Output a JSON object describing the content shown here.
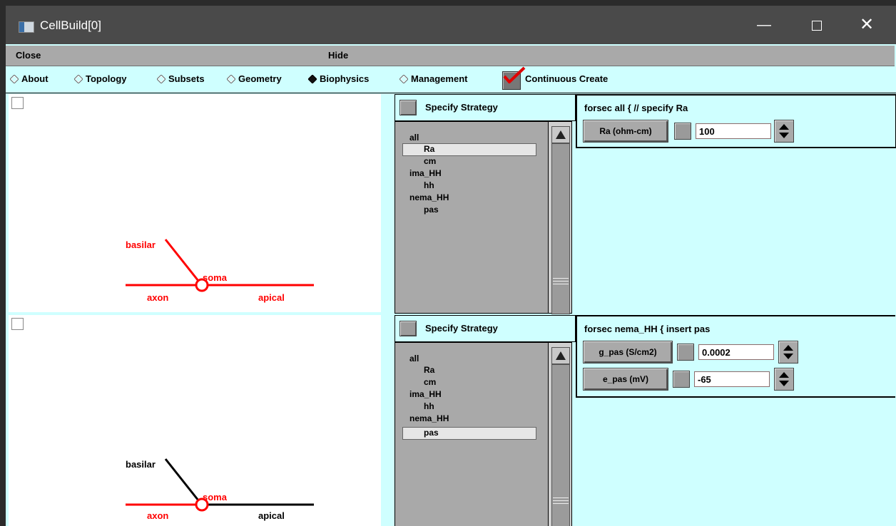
{
  "window": {
    "title": "CellBuild[0]"
  },
  "menu": {
    "close": "Close",
    "hide": "Hide"
  },
  "tabs": [
    {
      "label": "About",
      "selected": false
    },
    {
      "label": "Topology",
      "selected": false
    },
    {
      "label": "Subsets",
      "selected": false
    },
    {
      "label": "Geometry",
      "selected": false
    },
    {
      "label": "Biophysics",
      "selected": true
    },
    {
      "label": "Management",
      "selected": false
    }
  ],
  "continuous_create": {
    "label": "Continuous Create",
    "checked": true
  },
  "panels": [
    {
      "shape_labels": {
        "basilar": "basilar",
        "soma": "soma",
        "axon": "axon",
        "apical": "apical"
      },
      "strategy_label": "Specify Strategy",
      "list_items": [
        "all",
        "Ra",
        "cm",
        "ima_HH",
        "hh",
        "nema_HH",
        "pas"
      ],
      "selected_item": "Ra",
      "detail_header": "forsec all { // specify Ra",
      "params": [
        {
          "button": "Ra (ohm-cm)",
          "value": "100"
        }
      ]
    },
    {
      "shape_labels": {
        "basilar": "basilar",
        "soma": "soma",
        "axon": "axon",
        "apical": "apical"
      },
      "strategy_label": "Specify Strategy",
      "list_items": [
        "all",
        "Ra",
        "cm",
        "ima_HH",
        "hh",
        "nema_HH",
        "pas"
      ],
      "selected_item": "pas",
      "detail_header": "forsec nema_HH { insert pas",
      "params": [
        {
          "button": "g_pas (S/cm2)",
          "value": "0.0002"
        },
        {
          "button": "e_pas (mV)",
          "value": "-65"
        }
      ]
    }
  ],
  "colors": {
    "highlight": "#ff0000",
    "background": "#cfffff",
    "panel_gray": "#a9a9a9"
  }
}
